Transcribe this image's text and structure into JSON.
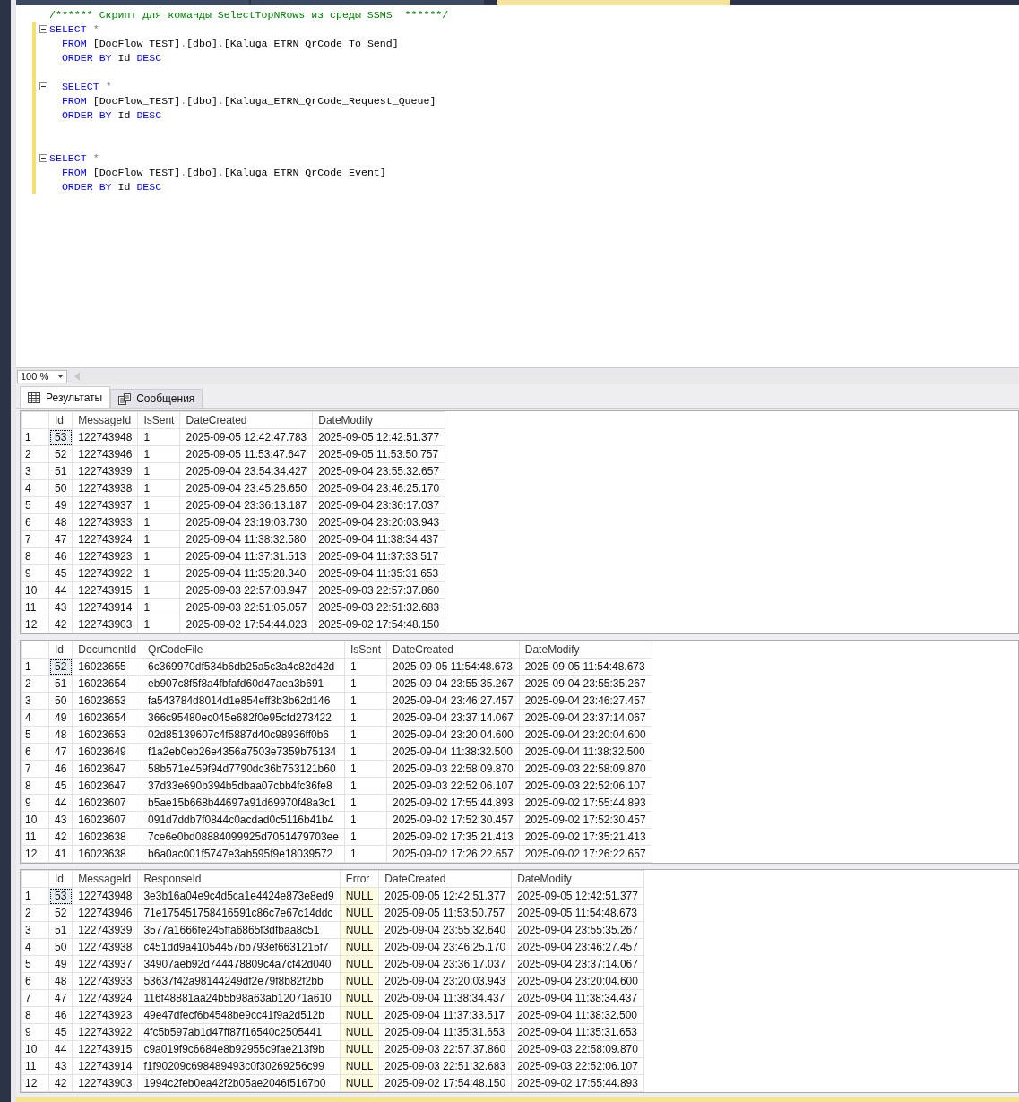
{
  "document_tabs": [
    {
      "selected": false
    },
    {
      "selected": false
    },
    {
      "selected": true
    }
  ],
  "editor": {
    "lines": [
      {
        "changed": false,
        "collapsible": false,
        "tokens": [
          {
            "text": "/****** Скрипт для команды SelectTopNRows из среды SSMS  ******/",
            "kind": "comment"
          }
        ]
      },
      {
        "changed": true,
        "collapsible": true,
        "tokens": [
          {
            "text": "SELECT",
            "kind": "keyword"
          },
          {
            "text": " *",
            "kind": "operator"
          }
        ]
      },
      {
        "changed": true,
        "collapsible": false,
        "tokens": [
          {
            "text": "  FROM",
            "kind": "keyword"
          },
          {
            "text": " [DocFlow_TEST]",
            "kind": "ident"
          },
          {
            "text": ".",
            "kind": "operator"
          },
          {
            "text": "[dbo]",
            "kind": "ident"
          },
          {
            "text": ".",
            "kind": "operator"
          },
          {
            "text": "[Kaluga_ETRN_QrCode_To_Send]",
            "kind": "ident"
          }
        ]
      },
      {
        "changed": true,
        "collapsible": false,
        "tokens": [
          {
            "text": "  ORDER BY",
            "kind": "keyword"
          },
          {
            "text": " Id",
            "kind": "ident"
          },
          {
            "text": " DESC",
            "kind": "keyword"
          }
        ]
      },
      {
        "changed": true,
        "collapsible": false
      },
      {
        "changed": true,
        "collapsible": true,
        "tokens": [
          {
            "text": "  SELECT",
            "kind": "keyword"
          },
          {
            "text": " *",
            "kind": "operator"
          }
        ]
      },
      {
        "changed": true,
        "collapsible": false,
        "tokens": [
          {
            "text": "  FROM",
            "kind": "keyword"
          },
          {
            "text": " [DocFlow_TEST]",
            "kind": "ident"
          },
          {
            "text": ".",
            "kind": "operator"
          },
          {
            "text": "[dbo]",
            "kind": "ident"
          },
          {
            "text": ".",
            "kind": "operator"
          },
          {
            "text": "[Kaluga_ETRN_QrCode_Request_Queue]",
            "kind": "ident"
          }
        ]
      },
      {
        "changed": true,
        "collapsible": false,
        "tokens": [
          {
            "text": "  ORDER BY",
            "kind": "keyword"
          },
          {
            "text": " Id",
            "kind": "ident"
          },
          {
            "text": " DESC",
            "kind": "keyword"
          }
        ]
      },
      {
        "changed": true,
        "collapsible": false
      },
      {
        "changed": true,
        "collapsible": false
      },
      {
        "changed": true,
        "collapsible": true,
        "tokens": [
          {
            "text": "SELECT",
            "kind": "keyword"
          },
          {
            "text": " *",
            "kind": "operator"
          }
        ]
      },
      {
        "changed": true,
        "collapsible": false,
        "tokens": [
          {
            "text": "  FROM",
            "kind": "keyword"
          },
          {
            "text": " [DocFlow_TEST]",
            "kind": "ident"
          },
          {
            "text": ".",
            "kind": "operator"
          },
          {
            "text": "[dbo]",
            "kind": "ident"
          },
          {
            "text": ".",
            "kind": "operator"
          },
          {
            "text": "[Kaluga_ETRN_QrCode_Event]",
            "kind": "ident"
          }
        ]
      },
      {
        "changed": true,
        "collapsible": false,
        "tokens": [
          {
            "text": "  ORDER BY",
            "kind": "keyword"
          },
          {
            "text": " Id",
            "kind": "ident"
          },
          {
            "text": " DESC",
            "kind": "keyword"
          }
        ]
      }
    ]
  },
  "zoom": {
    "value": "100 %"
  },
  "result_tabs": [
    {
      "label": "Результаты",
      "selected": true
    },
    {
      "label": "Сообщения",
      "selected": false
    }
  ],
  "grids": [
    {
      "columns": [
        {
          "label": "Id",
          "highlighted": false
        },
        {
          "label": "MessageId",
          "highlighted": false
        },
        {
          "label": "IsSent",
          "highlighted": false
        },
        {
          "label": "DateCreated",
          "highlighted": false
        },
        {
          "label": "DateModify",
          "highlighted": false
        }
      ],
      "rows": [
        {
          "number": "1",
          "focused": true,
          "cells": [
            "53",
            "122743948",
            "1",
            "2025-09-05 12:42:47.783",
            "2025-09-05 12:42:51.377"
          ]
        },
        {
          "number": "2",
          "focused": false,
          "cells": [
            "52",
            "122743946",
            "1",
            "2025-09-05 11:53:47.647",
            "2025-09-05 11:53:50.757"
          ]
        },
        {
          "number": "3",
          "focused": false,
          "cells": [
            "51",
            "122743939",
            "1",
            "2025-09-04 23:54:34.427",
            "2025-09-04 23:55:32.657"
          ]
        },
        {
          "number": "4",
          "focused": false,
          "cells": [
            "50",
            "122743938",
            "1",
            "2025-09-04 23:45:26.650",
            "2025-09-04 23:46:25.170"
          ]
        },
        {
          "number": "5",
          "focused": false,
          "cells": [
            "49",
            "122743937",
            "1",
            "2025-09-04 23:36:13.187",
            "2025-09-04 23:36:17.037"
          ]
        },
        {
          "number": "6",
          "focused": false,
          "cells": [
            "48",
            "122743933",
            "1",
            "2025-09-04 23:19:03.730",
            "2025-09-04 23:20:03.943"
          ]
        },
        {
          "number": "7",
          "focused": false,
          "cells": [
            "47",
            "122743924",
            "1",
            "2025-09-04 11:38:32.580",
            "2025-09-04 11:38:34.437"
          ]
        },
        {
          "number": "8",
          "focused": false,
          "cells": [
            "46",
            "122743923",
            "1",
            "2025-09-04 11:37:31.513",
            "2025-09-04 11:37:33.517"
          ]
        },
        {
          "number": "9",
          "focused": false,
          "cells": [
            "45",
            "122743922",
            "1",
            "2025-09-04 11:35:28.340",
            "2025-09-04 11:35:31.653"
          ]
        },
        {
          "number": "10",
          "focused": false,
          "cells": [
            "44",
            "122743915",
            "1",
            "2025-09-03 22:57:08.947",
            "2025-09-03 22:57:37.860"
          ]
        },
        {
          "number": "11",
          "focused": false,
          "cells": [
            "43",
            "122743914",
            "1",
            "2025-09-03 22:51:05.057",
            "2025-09-03 22:51:32.683"
          ]
        },
        {
          "number": "12",
          "focused": false,
          "cells": [
            "42",
            "122743903",
            "1",
            "2025-09-02 17:54:44.023",
            "2025-09-02 17:54:48.150"
          ]
        }
      ]
    },
    {
      "columns": [
        {
          "label": "Id",
          "highlighted": false
        },
        {
          "label": "DocumentId",
          "highlighted": false
        },
        {
          "label": "QrCodeFile",
          "highlighted": false
        },
        {
          "label": "IsSent",
          "highlighted": false
        },
        {
          "label": "DateCreated",
          "highlighted": false
        },
        {
          "label": "DateModify",
          "highlighted": false
        }
      ],
      "rows": [
        {
          "number": "1",
          "focused": true,
          "cells": [
            "52",
            "16023655",
            "6c369970df534b6db25a5c3a4c82d42d",
            "1",
            "2025-09-05 11:54:48.673",
            "2025-09-05 11:54:48.673"
          ]
        },
        {
          "number": "2",
          "focused": false,
          "cells": [
            "51",
            "16023654",
            "eb907c8f5f8a4fbfafd60d47aea3b691",
            "1",
            "2025-09-04 23:55:35.267",
            "2025-09-04 23:55:35.267"
          ]
        },
        {
          "number": "3",
          "focused": false,
          "cells": [
            "50",
            "16023653",
            "fa543784d8014d1e854eff3b3b62d146",
            "1",
            "2025-09-04 23:46:27.457",
            "2025-09-04 23:46:27.457"
          ]
        },
        {
          "number": "4",
          "focused": false,
          "cells": [
            "49",
            "16023654",
            "366c95480ec045e682f0e95cfd273422",
            "1",
            "2025-09-04 23:37:14.067",
            "2025-09-04 23:37:14.067"
          ]
        },
        {
          "number": "5",
          "focused": false,
          "cells": [
            "48",
            "16023653",
            "02d85139607c4f5887d40c98936ff0b6",
            "1",
            "2025-09-04 23:20:04.600",
            "2025-09-04 23:20:04.600"
          ]
        },
        {
          "number": "6",
          "focused": false,
          "cells": [
            "47",
            "16023649",
            "f1a2eb0eb26e4356a7503e7359b75134",
            "1",
            "2025-09-04 11:38:32.500",
            "2025-09-04 11:38:32.500"
          ]
        },
        {
          "number": "7",
          "focused": false,
          "cells": [
            "46",
            "16023647",
            "58b571e459f94d7790dc36b753121b60",
            "1",
            "2025-09-03 22:58:09.870",
            "2025-09-03 22:58:09.870"
          ]
        },
        {
          "number": "8",
          "focused": false,
          "cells": [
            "45",
            "16023647",
            "37d33e690b394b5dbaa07cbb4fc36fe8",
            "1",
            "2025-09-03 22:52:06.107",
            "2025-09-03 22:52:06.107"
          ]
        },
        {
          "number": "9",
          "focused": false,
          "cells": [
            "44",
            "16023607",
            "b5ae15b668b44697a91d69970f48a3c1",
            "1",
            "2025-09-02 17:55:44.893",
            "2025-09-02 17:55:44.893"
          ]
        },
        {
          "number": "10",
          "focused": false,
          "cells": [
            "43",
            "16023607",
            "091d7ddb7f0844c0acdad0c5116b41b4",
            "1",
            "2025-09-02 17:52:30.457",
            "2025-09-02 17:52:30.457"
          ]
        },
        {
          "number": "11",
          "focused": false,
          "cells": [
            "42",
            "16023638",
            "7ce6e0bd08884099925d7051479703ee",
            "1",
            "2025-09-02 17:35:21.413",
            "2025-09-02 17:35:21.413"
          ]
        },
        {
          "number": "12",
          "focused": false,
          "cells": [
            "41",
            "16023638",
            "b6a0ac001f5747e3ab595f9e18039572",
            "1",
            "2025-09-02 17:26:22.657",
            "2025-09-02 17:26:22.657"
          ]
        }
      ]
    },
    {
      "columns": [
        {
          "label": "Id",
          "highlighted": false
        },
        {
          "label": "MessageId",
          "highlighted": false
        },
        {
          "label": "ResponseId",
          "highlighted": false
        },
        {
          "label": "Error",
          "highlighted": true
        },
        {
          "label": "DateCreated",
          "highlighted": false
        },
        {
          "label": "DateModify",
          "highlighted": false
        }
      ],
      "rows": [
        {
          "number": "1",
          "focused": true,
          "cells": [
            "53",
            "122743948",
            "3e3b16a04e9c4d5ca1e4424e873e8ed9",
            "NULL",
            "2025-09-05 12:42:51.377",
            "2025-09-05 12:42:51.377"
          ]
        },
        {
          "number": "2",
          "focused": false,
          "cells": [
            "52",
            "122743946",
            "71e175451758416591c86c7e67c14ddc",
            "NULL",
            "2025-09-05 11:53:50.757",
            "2025-09-05 11:54:48.673"
          ]
        },
        {
          "number": "3",
          "focused": false,
          "cells": [
            "51",
            "122743939",
            "3577a1666fe245ffa6865f3dfbaa8c51",
            "NULL",
            "2025-09-04 23:55:32.640",
            "2025-09-04 23:55:35.267"
          ]
        },
        {
          "number": "4",
          "focused": false,
          "cells": [
            "50",
            "122743938",
            "c451dd9a41054457bb793ef6631215f7",
            "NULL",
            "2025-09-04 23:46:25.170",
            "2025-09-04 23:46:27.457"
          ]
        },
        {
          "number": "5",
          "focused": false,
          "cells": [
            "49",
            "122743937",
            "34907aeb92d744478809c4a7cf42d040",
            "NULL",
            "2025-09-04 23:36:17.037",
            "2025-09-04 23:37:14.067"
          ]
        },
        {
          "number": "6",
          "focused": false,
          "cells": [
            "48",
            "122743933",
            "53637f42a98144249df2e79f8b82f2bb",
            "NULL",
            "2025-09-04 23:20:03.943",
            "2025-09-04 23:20:04.600"
          ]
        },
        {
          "number": "7",
          "focused": false,
          "cells": [
            "47",
            "122743924",
            "116f48881aa24b5b98a63ab12071a610",
            "NULL",
            "2025-09-04 11:38:34.437",
            "2025-09-04 11:38:34.437"
          ]
        },
        {
          "number": "8",
          "focused": false,
          "cells": [
            "46",
            "122743923",
            "49e47dfecf6b4548be9cc41f9a2d512b",
            "NULL",
            "2025-09-04 11:37:33.517",
            "2025-09-04 11:38:32.500"
          ]
        },
        {
          "number": "9",
          "focused": false,
          "cells": [
            "45",
            "122743922",
            "4fc5b597ab1d47ff87f16540c2505441",
            "NULL",
            "2025-09-04 11:35:31.653",
            "2025-09-04 11:35:31.653"
          ]
        },
        {
          "number": "10",
          "focused": false,
          "cells": [
            "44",
            "122743915",
            "c9a019f9c6684e8b92955c9fae213f9b",
            "NULL",
            "2025-09-03 22:57:37.860",
            "2025-09-03 22:58:09.870"
          ]
        },
        {
          "number": "11",
          "focused": false,
          "cells": [
            "43",
            "122743914",
            "f1f90209c698489493c0f30269256c99",
            "NULL",
            "2025-09-03 22:51:32.683",
            "2025-09-03 22:52:06.107"
          ]
        },
        {
          "number": "12",
          "focused": false,
          "cells": [
            "42",
            "122743903",
            "1994c2feb0ea42f2b05ae2046f5167b0",
            "NULL",
            "2025-09-02 17:54:48.150",
            "2025-09-02 17:55:44.893"
          ]
        }
      ]
    }
  ]
}
